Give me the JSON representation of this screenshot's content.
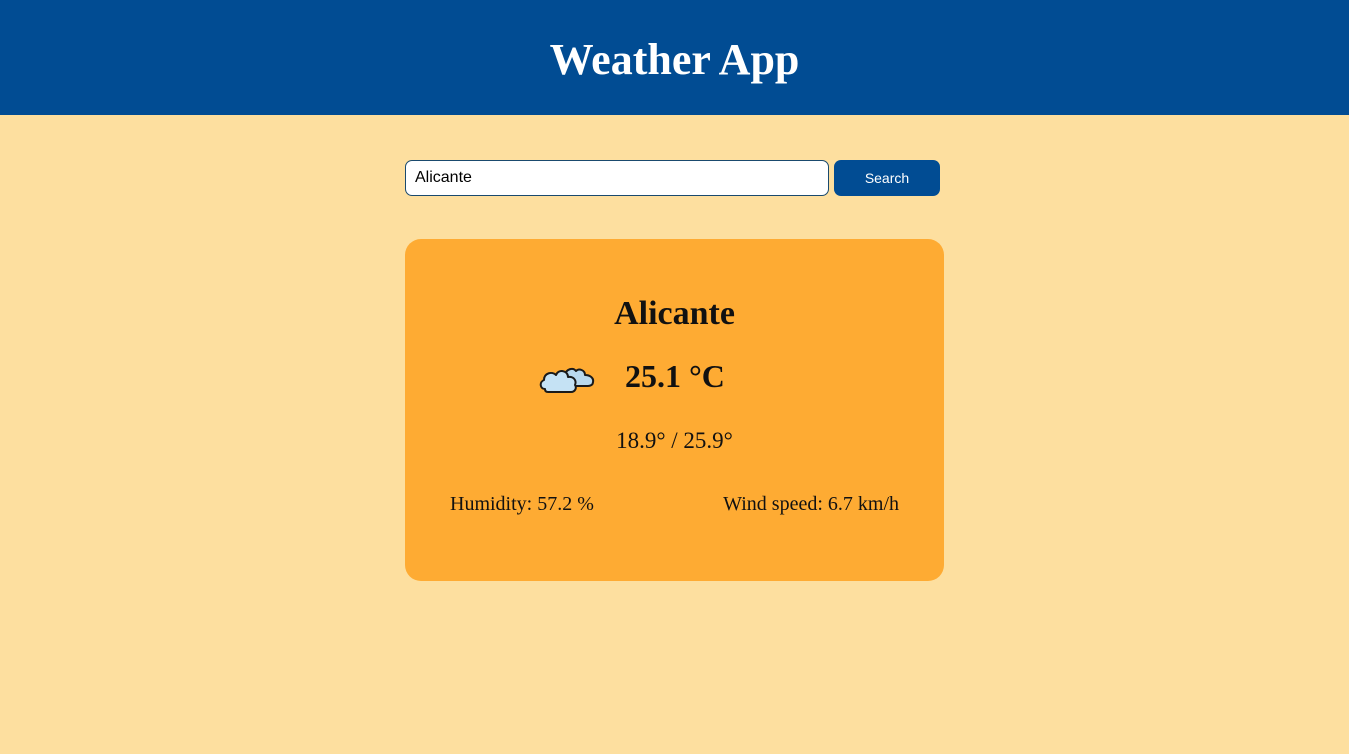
{
  "header": {
    "title": "Weather App",
    "background": "#014c93"
  },
  "search": {
    "value": "Alicante",
    "button_label": "Search"
  },
  "weather": {
    "city": "Alicante",
    "icon": "cloudy-icon",
    "temperature": "25.1 °C",
    "min_max": "18.9° / 25.9°",
    "humidity": "Humidity: 57.2 %",
    "wind_speed": "Wind speed: 6.7 km/h"
  },
  "colors": {
    "page_background": "#fddf9f",
    "card_background": "#feab33",
    "accent": "#014c93"
  }
}
